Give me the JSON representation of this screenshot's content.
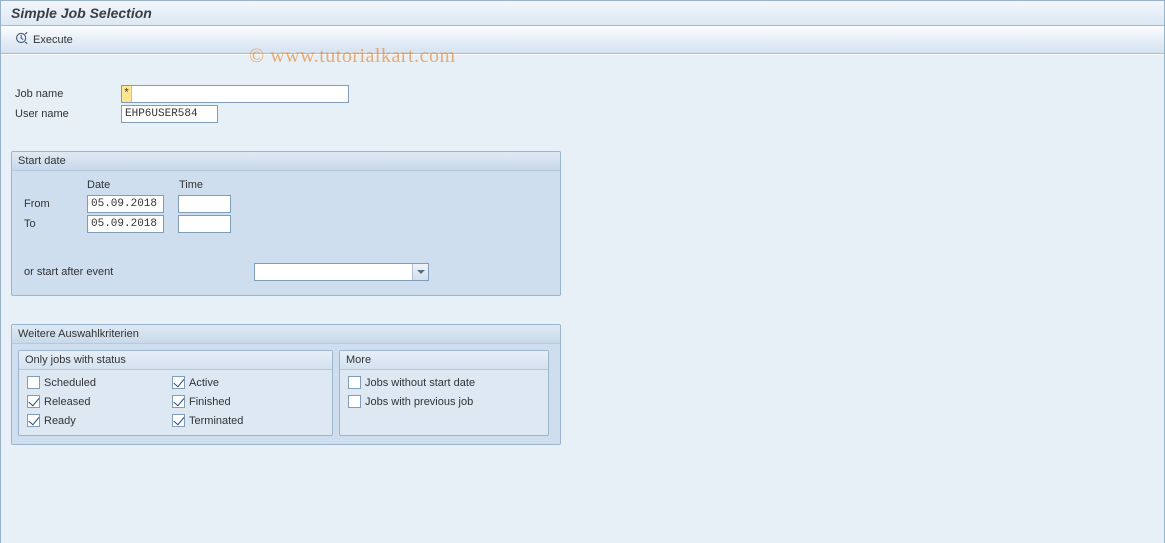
{
  "header": {
    "title": "Simple Job Selection"
  },
  "toolbar": {
    "execute_label": "Execute"
  },
  "watermark": "© www.tutorialkart.com",
  "form": {
    "job_name_label": "Job name",
    "job_name_prefix": "*",
    "job_name_value": "",
    "user_name_label": "User name",
    "user_name_value": "EHP6USER584"
  },
  "start_date": {
    "title": "Start date",
    "col_date": "Date",
    "col_time": "Time",
    "from_label": "From",
    "from_date": "05.09.2018",
    "from_time": "",
    "to_label": "To",
    "to_date": "05.09.2018",
    "to_time": "",
    "event_label": "or start after event",
    "event_value": ""
  },
  "further": {
    "title": "Weitere Auswahlkriterien",
    "status": {
      "title": "Only jobs with status",
      "scheduled": {
        "label": "Scheduled",
        "checked": false
      },
      "released": {
        "label": "Released",
        "checked": true
      },
      "ready": {
        "label": "Ready",
        "checked": true
      },
      "active": {
        "label": "Active",
        "checked": true
      },
      "finished": {
        "label": "Finished",
        "checked": true
      },
      "terminated": {
        "label": "Terminated",
        "checked": true
      }
    },
    "more": {
      "title": "More",
      "no_start": {
        "label": "Jobs without start date",
        "checked": false
      },
      "prev_job": {
        "label": "Jobs with previous job",
        "checked": false
      }
    }
  }
}
